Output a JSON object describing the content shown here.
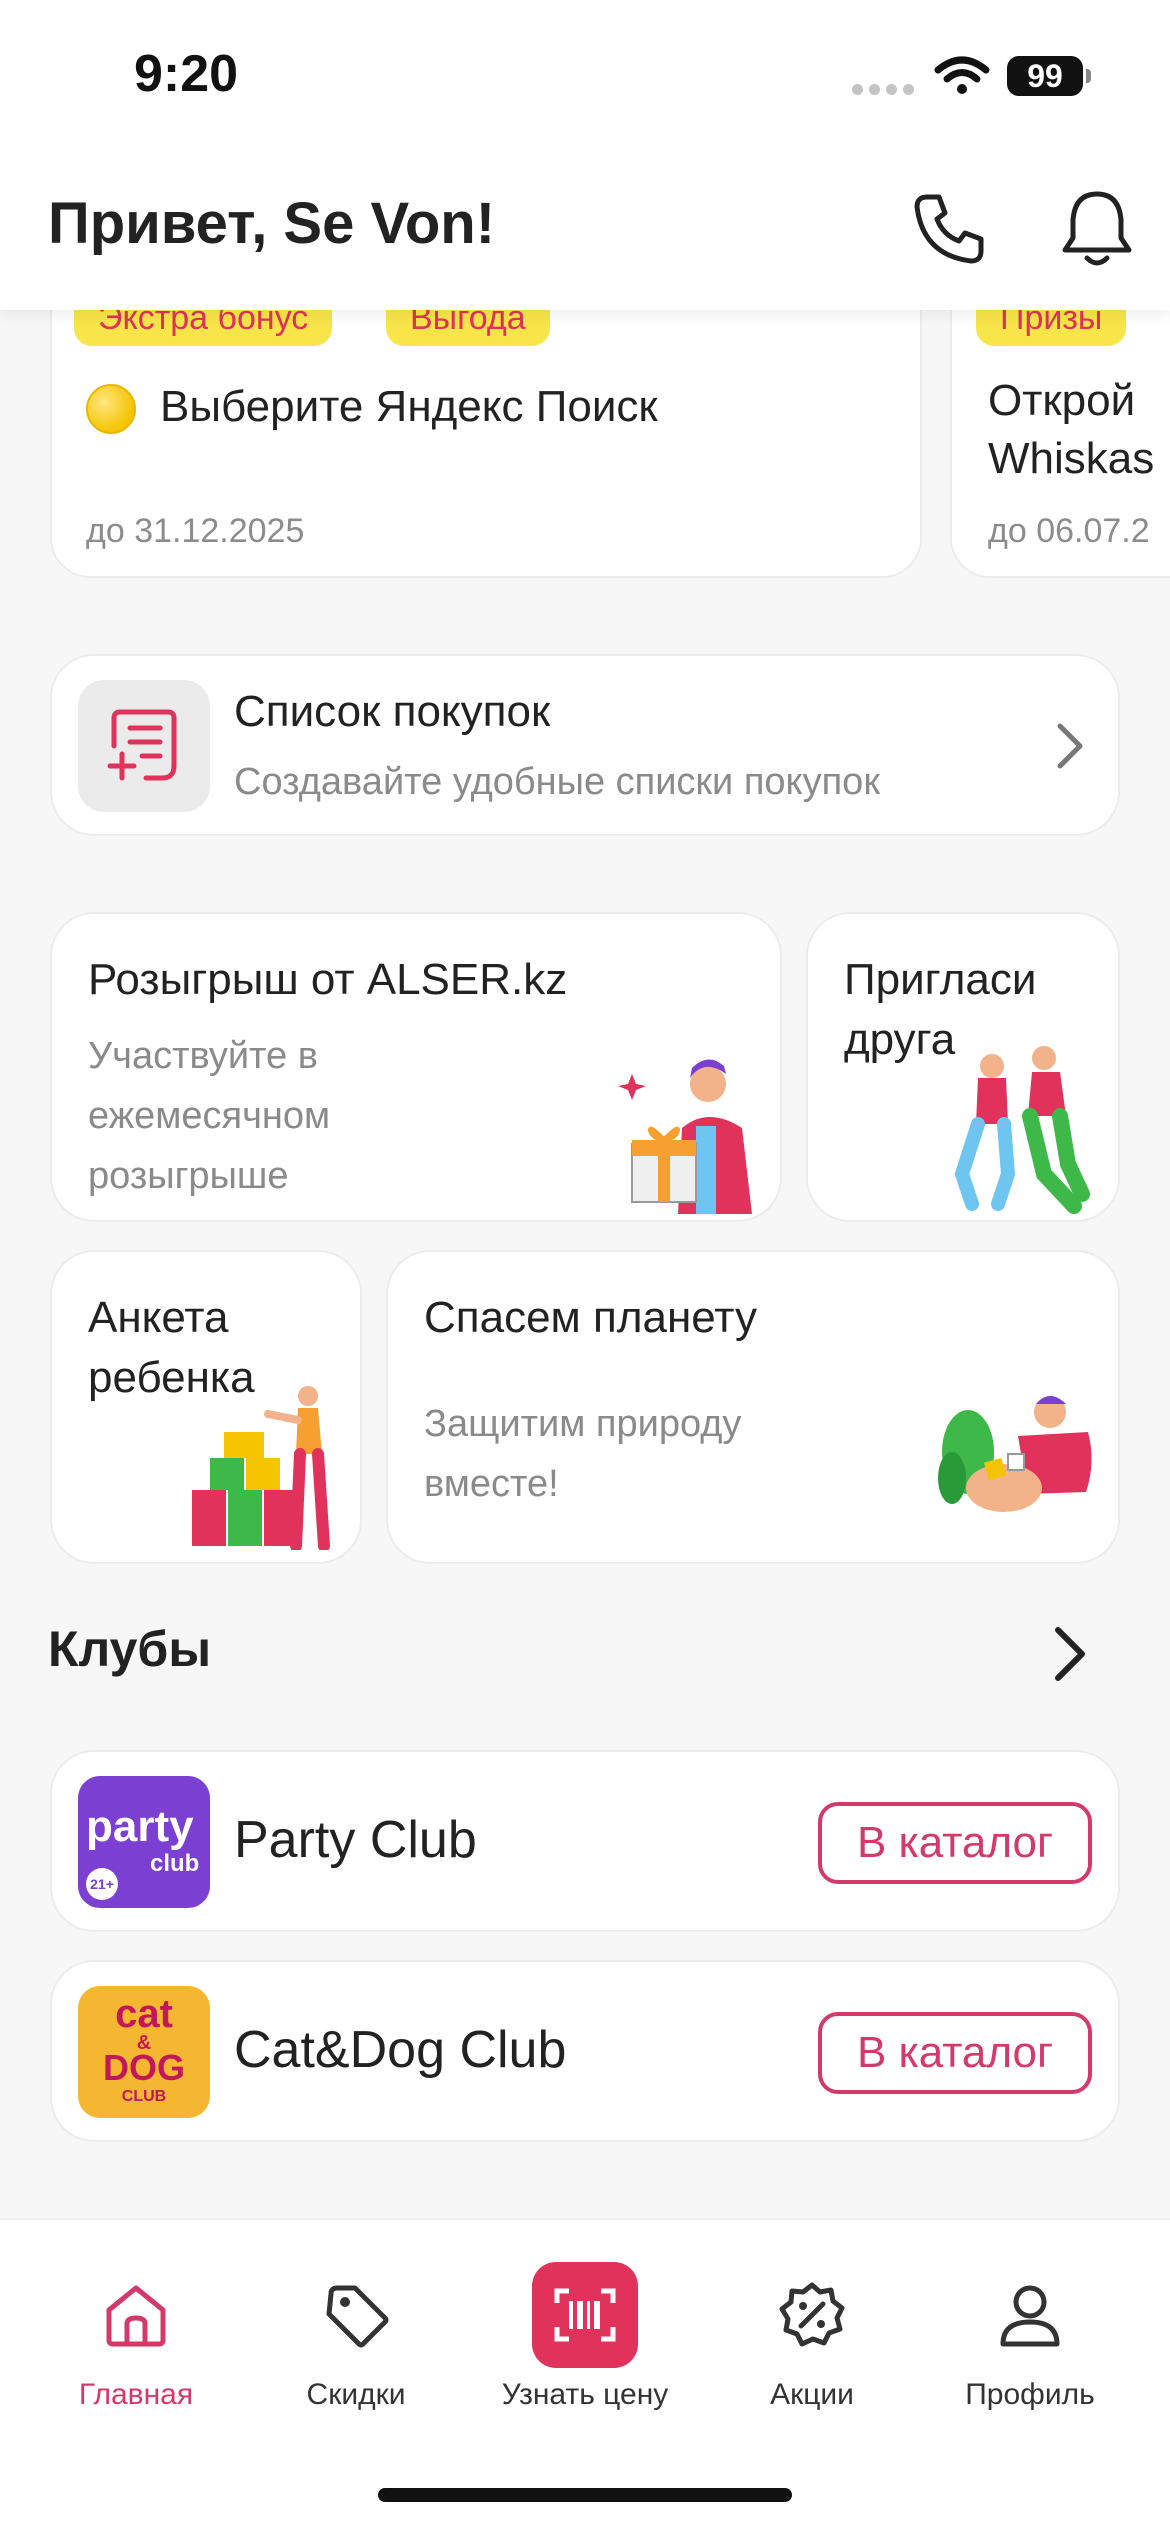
{
  "status": {
    "time": "9:20",
    "battery": "99"
  },
  "header": {
    "greeting": "Привет, Se Von!"
  },
  "offers": [
    {
      "tags": [
        "Экстра бонус",
        "Выгода"
      ],
      "title": "Выберите Яндекс Поиск",
      "date": "до 31.12.2025"
    },
    {
      "tags": [
        "Призы"
      ],
      "title_line1": "Открой",
      "title_line2": "Whiskas",
      "date": "до 06.07.2"
    }
  ],
  "shopping_list": {
    "title": "Список покупок",
    "subtitle": "Создавайте удобные списки покупок"
  },
  "promos": {
    "raffle": {
      "title": "Розыгрыш от ALSER.kz",
      "sub1": "Участвуйте в",
      "sub2": "ежемесячном",
      "sub3": "розыгрыше"
    },
    "invite": {
      "line1": "Пригласи",
      "line2": "друга"
    },
    "child": {
      "line1": "Анкета",
      "line2": "ребенка"
    },
    "planet": {
      "title": "Спасем планету",
      "sub1": "Защитим природу",
      "sub2": "вместе!"
    }
  },
  "clubs": {
    "title": "Клубы",
    "items": [
      {
        "name": "Party Club",
        "button": "В каталог",
        "logo_line1": "party",
        "logo_line2": "club",
        "logo_badge": "21+"
      },
      {
        "name": "Cat&Dog Club",
        "button": "В каталог",
        "logo_line1": "cat",
        "logo_amp": "&",
        "logo_line2": "DOG",
        "logo_line3": "CLUB"
      }
    ]
  },
  "tabs": [
    {
      "label": "Главная",
      "icon": "home-icon"
    },
    {
      "label": "Скидки",
      "icon": "tag-icon"
    },
    {
      "label": "Узнать цену",
      "icon": "barcode-scan-icon"
    },
    {
      "label": "Акции",
      "icon": "percent-badge-icon"
    },
    {
      "label": "Профиль",
      "icon": "profile-icon"
    }
  ],
  "colors": {
    "accent": "#e0325a",
    "tag_bg": "#f8e54a",
    "active_tab": "#d33a6a"
  }
}
